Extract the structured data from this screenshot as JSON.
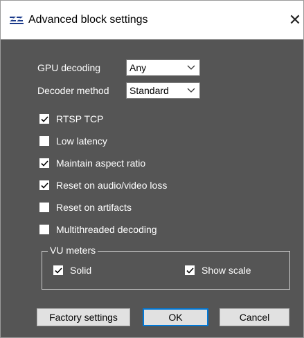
{
  "window": {
    "title": "Advanced block settings",
    "app_icon": "zz-logo-icon",
    "close_icon": "close-icon",
    "close_glyph": "✕"
  },
  "fields": {
    "gpu_decoding": {
      "label": "GPU decoding",
      "value": "Any"
    },
    "decoder_method": {
      "label": "Decoder method",
      "value": "Standard"
    }
  },
  "options": [
    {
      "label": "RTSP TCP",
      "checked": true
    },
    {
      "label": "Low latency",
      "checked": false
    },
    {
      "label": "Maintain aspect ratio",
      "checked": true
    },
    {
      "label": "Reset on audio/video loss",
      "checked": true
    },
    {
      "label": "Reset on artifacts",
      "checked": false
    },
    {
      "label": "Multithreaded decoding",
      "checked": false
    }
  ],
  "vu_meters": {
    "legend": "VU meters",
    "solid": {
      "label": "Solid",
      "checked": true
    },
    "show_scale": {
      "label": "Show scale",
      "checked": true
    }
  },
  "buttons": {
    "factory": "Factory settings",
    "ok": "OK",
    "cancel": "Cancel"
  },
  "colors": {
    "dialog_bg": "#555555",
    "ok_border": "#0078d7"
  }
}
